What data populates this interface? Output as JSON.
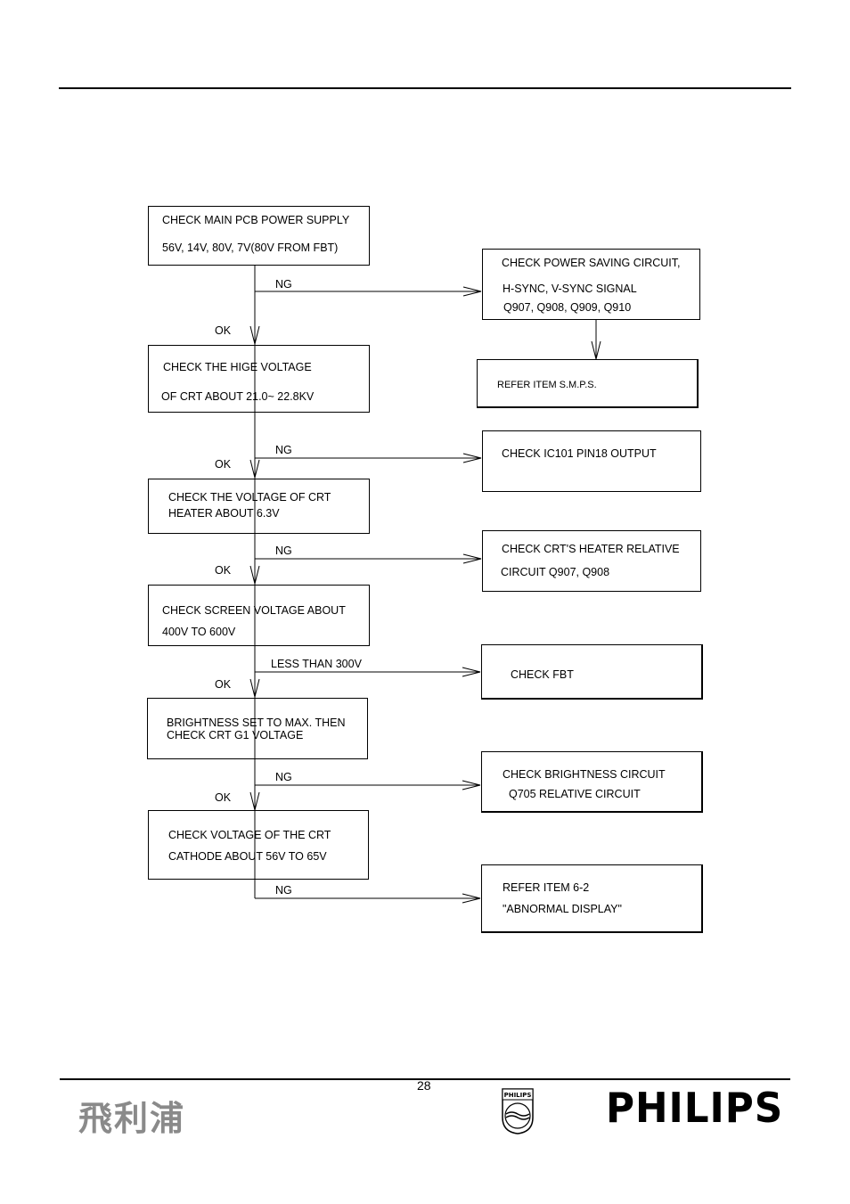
{
  "flowchart": {
    "main_steps": [
      {
        "lines": [
          "CHECK MAIN PCB POWER SUPPLY",
          "56V, 14V, 80V, 7V(80V FROM FBT)"
        ]
      },
      {
        "lines": [
          "CHECK THE HIGE VOLTAGE",
          "OF CRT ABOUT 21.0~ 22.8KV"
        ]
      },
      {
        "lines": [
          "CHECK THE VOLTAGE OF CRT",
          "HEATER ABOUT 6.3V"
        ]
      },
      {
        "lines": [
          "CHECK SCREEN VOLTAGE ABOUT",
          "400V TO 600V"
        ]
      },
      {
        "lines": [
          "BRIGHTNESS SET TO MAX. THEN",
          "CHECK CRT G1 VOLTAGE"
        ]
      },
      {
        "lines": [
          "CHECK VOLTAGE OF THE CRT",
          "CATHODE ABOUT 56V TO 65V"
        ]
      }
    ],
    "side_steps": [
      {
        "lines": [
          "CHECK POWER SAVING CIRCUIT,",
          "H-SYNC, V-SYNC SIGNAL",
          "Q907, Q908, Q909, Q910"
        ]
      },
      {
        "lines": [
          "REFER ITEM S.M.P.S."
        ]
      },
      {
        "lines": [
          "CHECK IC101 PIN18 OUTPUT"
        ]
      },
      {
        "lines": [
          "CHECK CRT'S HEATER RELATIVE",
          "CIRCUIT Q907, Q908"
        ]
      },
      {
        "lines": [
          "CHECK FBT"
        ]
      },
      {
        "lines": [
          "CHECK BRIGHTNESS CIRCUIT",
          "Q705 RELATIVE CIRCUIT"
        ]
      },
      {
        "lines": [
          "REFER ITEM 6-2",
          "\"ABNORMAL DISPLAY\""
        ]
      }
    ],
    "branch_labels": [
      "NG",
      "NG",
      "NG",
      "LESS THAN 300V",
      "NG",
      "NG"
    ],
    "ok_labels": [
      "OK",
      "OK",
      "OK",
      "OK",
      "OK"
    ]
  },
  "footer": {
    "page_number": "28",
    "logo_chinese": "飛利浦",
    "logo_brand": "PHILIPS",
    "shield_text": "PHILIPS"
  }
}
